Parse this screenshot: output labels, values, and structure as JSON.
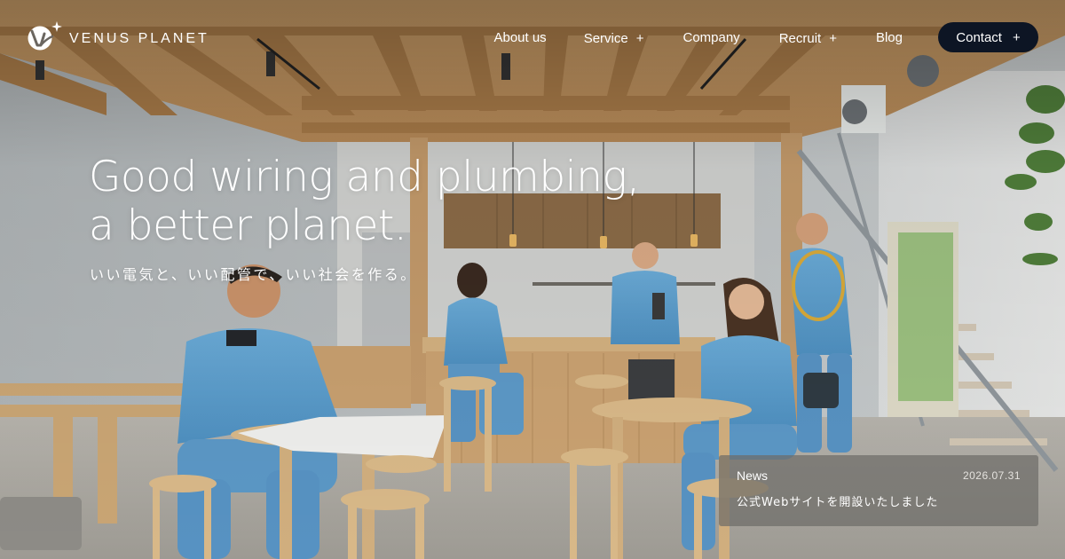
{
  "brand": {
    "name": "VENUS PLANET",
    "logo_icon": "venus-planet-logo-icon"
  },
  "nav": {
    "items": [
      {
        "label": "About us",
        "has_submenu": false
      },
      {
        "label": "Service",
        "has_submenu": true
      },
      {
        "label": "Company",
        "has_submenu": false
      },
      {
        "label": "Recruit",
        "has_submenu": true
      },
      {
        "label": "Blog",
        "has_submenu": false
      }
    ],
    "submenu_icon": "+",
    "contact": {
      "label": "Contact",
      "icon": "+"
    }
  },
  "hero": {
    "title_line1": "Good wiring and plumbing,",
    "title_line2": "a better planet.",
    "subtitle": "いい電気と、いい配管で、いい社会を作る。",
    "background_image": "photo-of-workers-in-blue-uniforms-in-wooden-house-interior"
  },
  "news": {
    "label": "News",
    "date": "2026.07.31",
    "title": "公式Webサイトを開設いたしました"
  },
  "colors": {
    "contact_bg": "#0d1524",
    "text_light": "#ffffff",
    "uniform_blue": "#5b9fce",
    "wood": "#c49a66"
  }
}
